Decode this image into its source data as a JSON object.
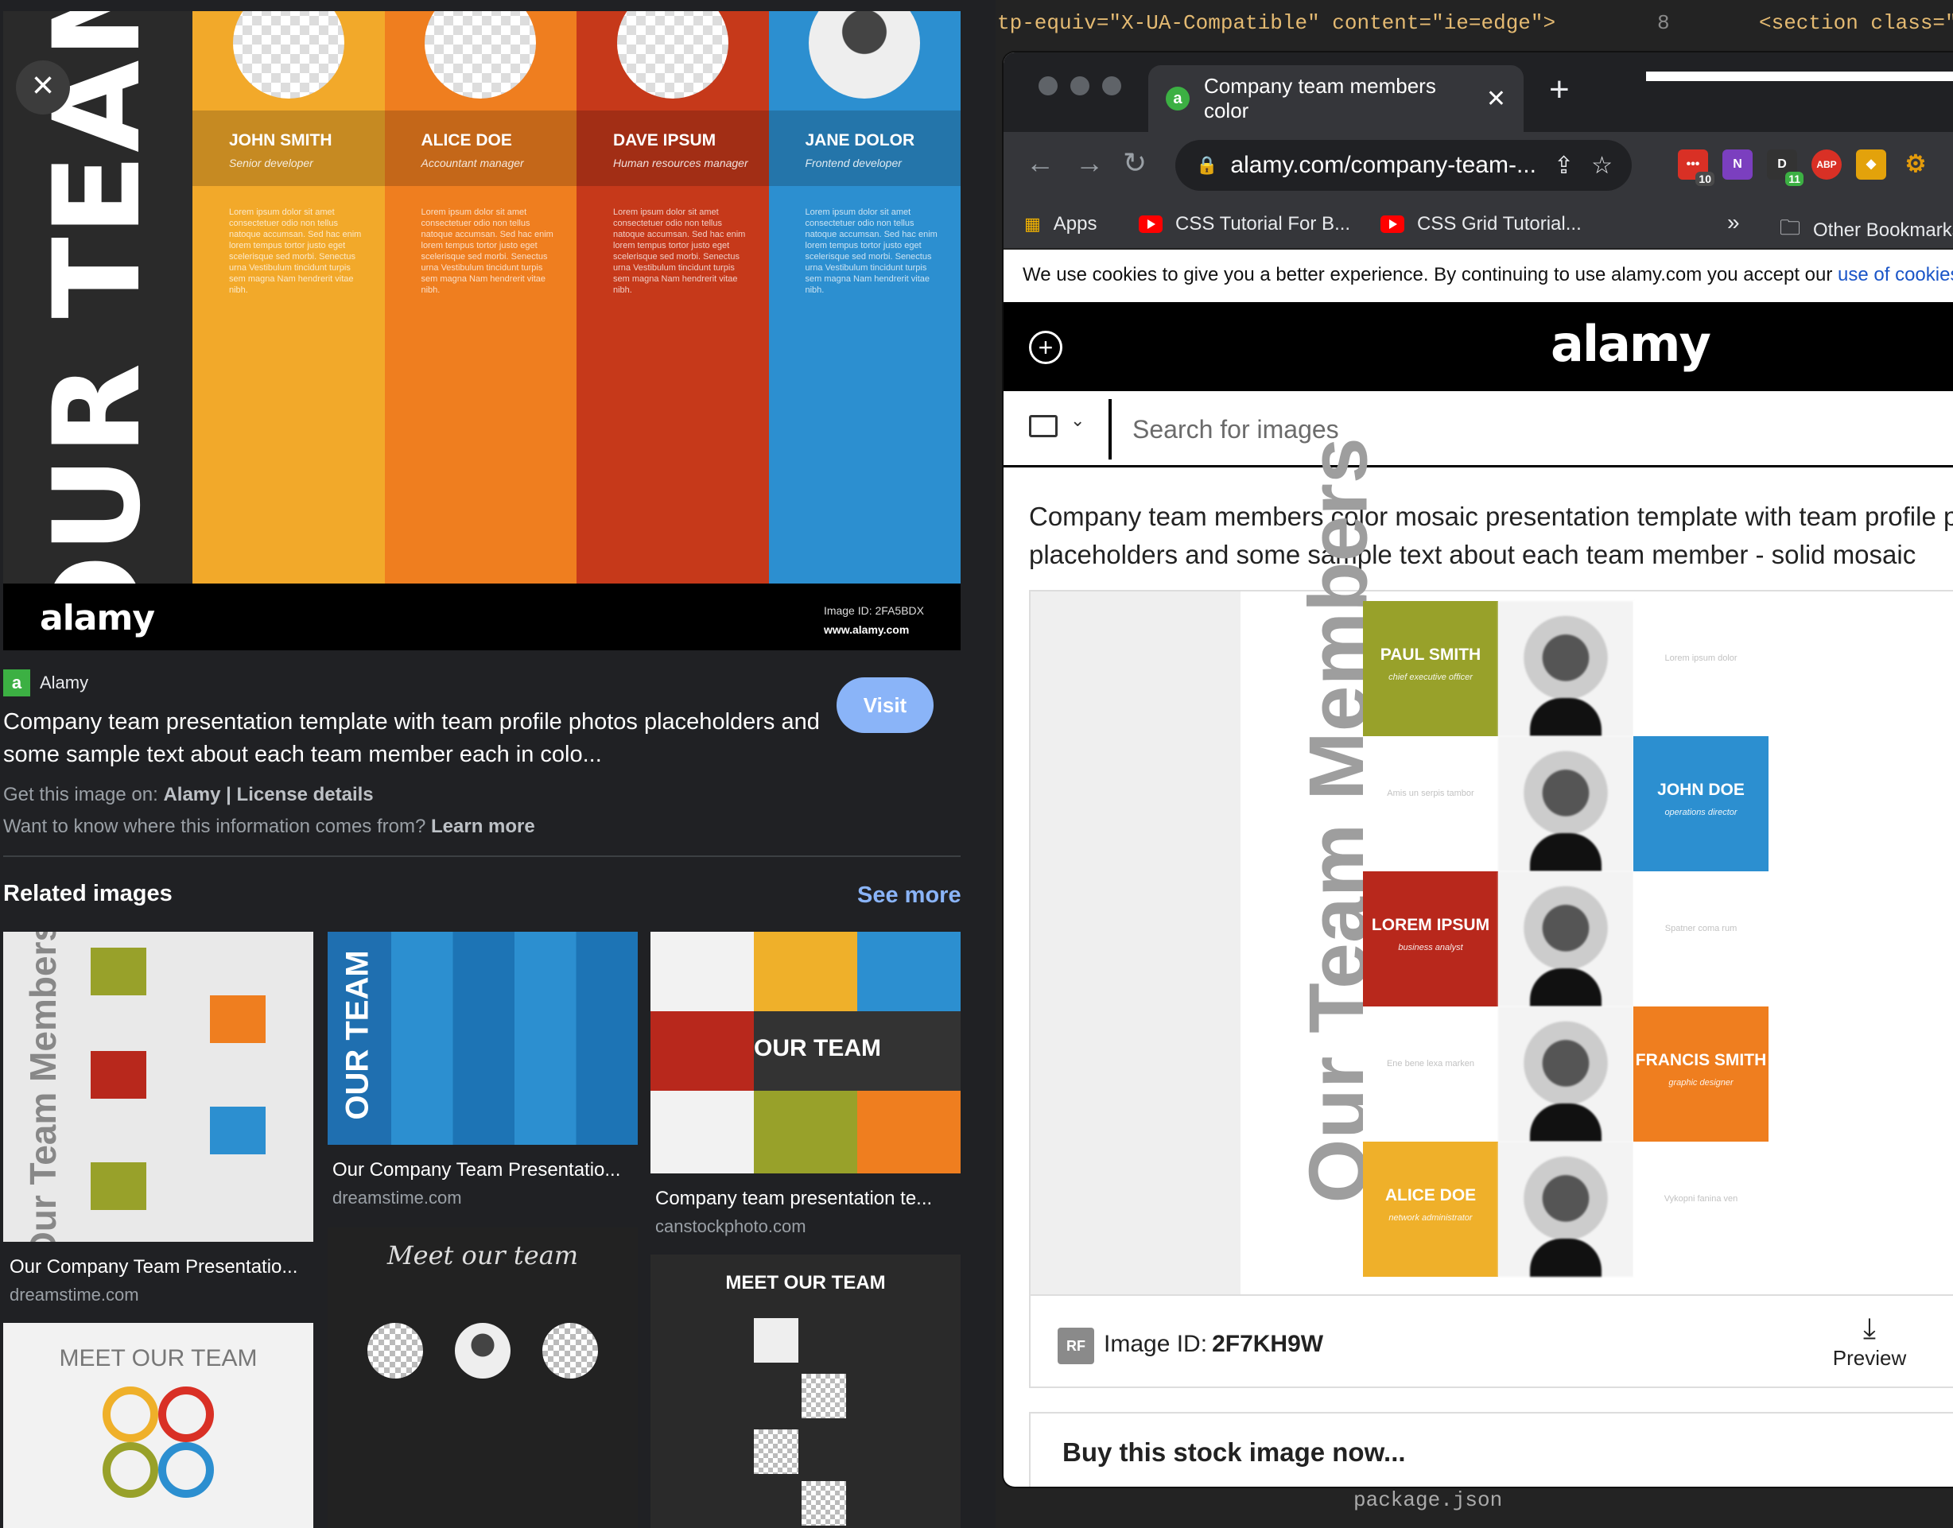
{
  "editor": {
    "code_left": "tp-equiv=\"X-UA-Compatible\" content=\"ie=edge\">",
    "line_no": "8",
    "code_right": "<section class=\"m",
    "file_label": "package.json"
  },
  "gpanel": {
    "hero": {
      "vertical_title": "OUR TEAM",
      "members": [
        {
          "name": "JOHN SMITH",
          "role": "Senior developer",
          "color": "#f2a92a"
        },
        {
          "name": "ALICE DOE",
          "role": "Accountant manager",
          "color": "#ef7e1f"
        },
        {
          "name": "DAVE IPSUM",
          "role": "Human resources manager",
          "color": "#c6391a"
        },
        {
          "name": "JANE DOLOR",
          "role": "Frontend developer",
          "color": "#2c8fd0"
        }
      ],
      "lorem": "Lorem ipsum dolor sit amet consectetuer odio non tellus natoque accumsan. Sed hac enim lorem tempus tortor justo eget scelerisque sed morbi. Senectus urna Vestibulum tincidunt turpis sem magna Nam hendrerit vitae nibh.",
      "footer_logo": "alamy",
      "image_id": "Image ID: 2FA5BDX",
      "site": "www.alamy.com"
    },
    "close_label": "×",
    "source": {
      "favicon": "a",
      "name": "Alamy"
    },
    "title": "Company team presentation template with team profile photos placeholders and some sample text about each team member each in colo...",
    "visit_label": "Visit",
    "get_prefix": "Get this image on:",
    "get_site": "Alamy",
    "get_sep": "|",
    "license": "License details",
    "want_text": "Want to know where this information comes from?",
    "learn_more": "Learn more",
    "related_label": "Related images",
    "see_more": "See more",
    "related": [
      {
        "caption": "Our Company Team Presentatio...",
        "domain": "dreamstime.com",
        "tile_title": "Our Team Members"
      },
      {
        "caption": "Our Company Team Presentatio...",
        "domain": "dreamstime.com",
        "tile_title": "OUR TEAM"
      },
      {
        "caption": "Company team presentation te...",
        "domain": "canstockphoto.com",
        "tile_title": "OUR TEAM"
      },
      {
        "caption": "",
        "domain": "",
        "tile_title": "MEET OUR TEAM"
      },
      {
        "caption": "",
        "domain": "",
        "tile_title": "Meet our team"
      },
      {
        "caption": "",
        "domain": "",
        "tile_title": "MEET OUR TEAM"
      }
    ]
  },
  "browser": {
    "tab_title": "Company team members color",
    "tab_favicon": "a",
    "url": "alamy.com/company-team-...",
    "extensions": [
      {
        "label": "•••",
        "badge": "10",
        "color": "#d93025"
      },
      {
        "label": "N",
        "badge": "",
        "color": "#7b3fbf"
      },
      {
        "label": "D",
        "badge": "11",
        "color": "#333333"
      },
      {
        "label": "ABP",
        "badge": "",
        "color": "#d93025"
      },
      {
        "label": "◆",
        "badge": "",
        "color": "#e3a20b"
      },
      {
        "label": "⚙",
        "badge": "",
        "color": "#e39b0b"
      }
    ],
    "bookmarks": {
      "apps": "Apps",
      "b1": "CSS Tutorial For B...",
      "b2": "CSS Grid Tutorial...",
      "more": "»",
      "other": "Other Bookmarks"
    },
    "cookie_text": "We use cookies to give you a better experience. By continuing to use alamy.com you accept our",
    "cookie_link": "use of cookies",
    "site_logo": "alamy",
    "search_placeholder": "Search for images",
    "description": "Company team members color mosaic presentation template with team profile photos placeholders and some sample text about each team member - solid mosaic",
    "mosaic": {
      "vertical_title": "Our Team Members",
      "blocks": [
        {
          "name": "PAUL SMITH",
          "role": "chief executive officer",
          "color": "#98a12a"
        },
        {
          "name": "JOHN DOE",
          "role": "operations director",
          "color": "#2c8fd0"
        },
        {
          "name": "LOREM IPSUM",
          "role": "business analyst",
          "color": "#b8281c"
        },
        {
          "name": "FRANCIS SMITH",
          "role": "graphic designer",
          "color": "#ef7e1f"
        },
        {
          "name": "ALICE DOE",
          "role": "network administrator",
          "color": "#efb02a"
        }
      ],
      "side_notes": [
        "Lorem ipsum dolor",
        "Amis un serpis tambor",
        "Spatner coma rum",
        "Ene bene lexa marken",
        "Vykopni fanina ven"
      ]
    },
    "rf_badge": "RF",
    "image_id_label": "Image ID:",
    "image_id": "2F7KH9W",
    "preview_label": "Preview",
    "buy_label": "Buy this stock image now..."
  }
}
